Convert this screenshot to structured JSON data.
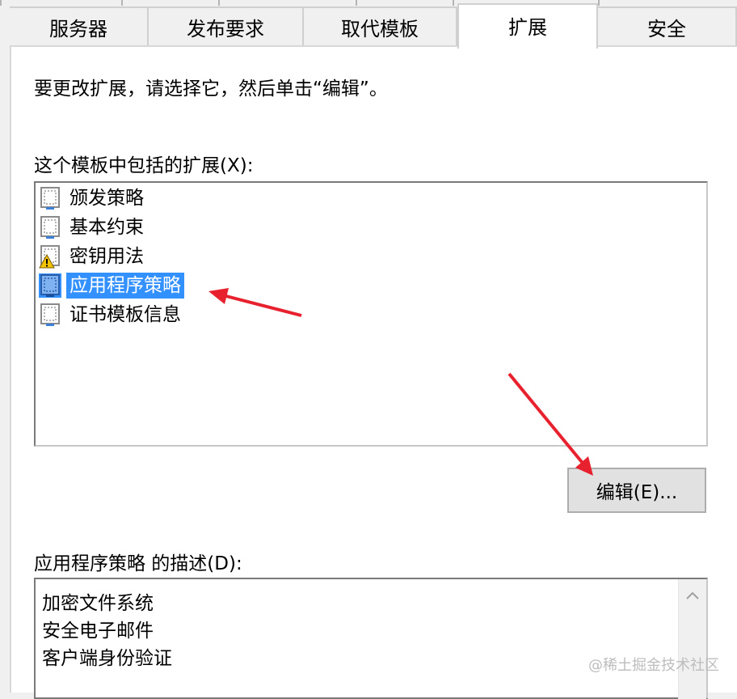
{
  "tabs": [
    {
      "label": "服务器"
    },
    {
      "label": "发布要求"
    },
    {
      "label": "取代模板"
    },
    {
      "label": "扩展"
    },
    {
      "label": "安全"
    }
  ],
  "active_tab": "扩展",
  "extensions_page": {
    "instruction": "要更改扩展，请选择它，然后单击“编辑”。",
    "list_label": "这个模板中包括的扩展(X):",
    "items": [
      {
        "label": "颁发策略",
        "icon": "certificate-icon"
      },
      {
        "label": "基本约束",
        "icon": "certificate-icon"
      },
      {
        "label": "密钥用法",
        "icon": "certificate-warning-icon"
      },
      {
        "label": "应用程序策略",
        "icon": "certificate-icon",
        "selected": true
      },
      {
        "label": "证书模板信息",
        "icon": "certificate-icon"
      }
    ],
    "edit_button": "编辑(E)...",
    "description_label": "应用程序策略 的描述(D):",
    "description_lines": [
      "加密文件系统",
      "安全电子邮件",
      "客户端身份验证"
    ]
  },
  "watermark": "@稀土掘金技术社区",
  "colors": {
    "selection": "#3390ff",
    "arrow": "#e8212e",
    "warning": "#f5c400"
  }
}
